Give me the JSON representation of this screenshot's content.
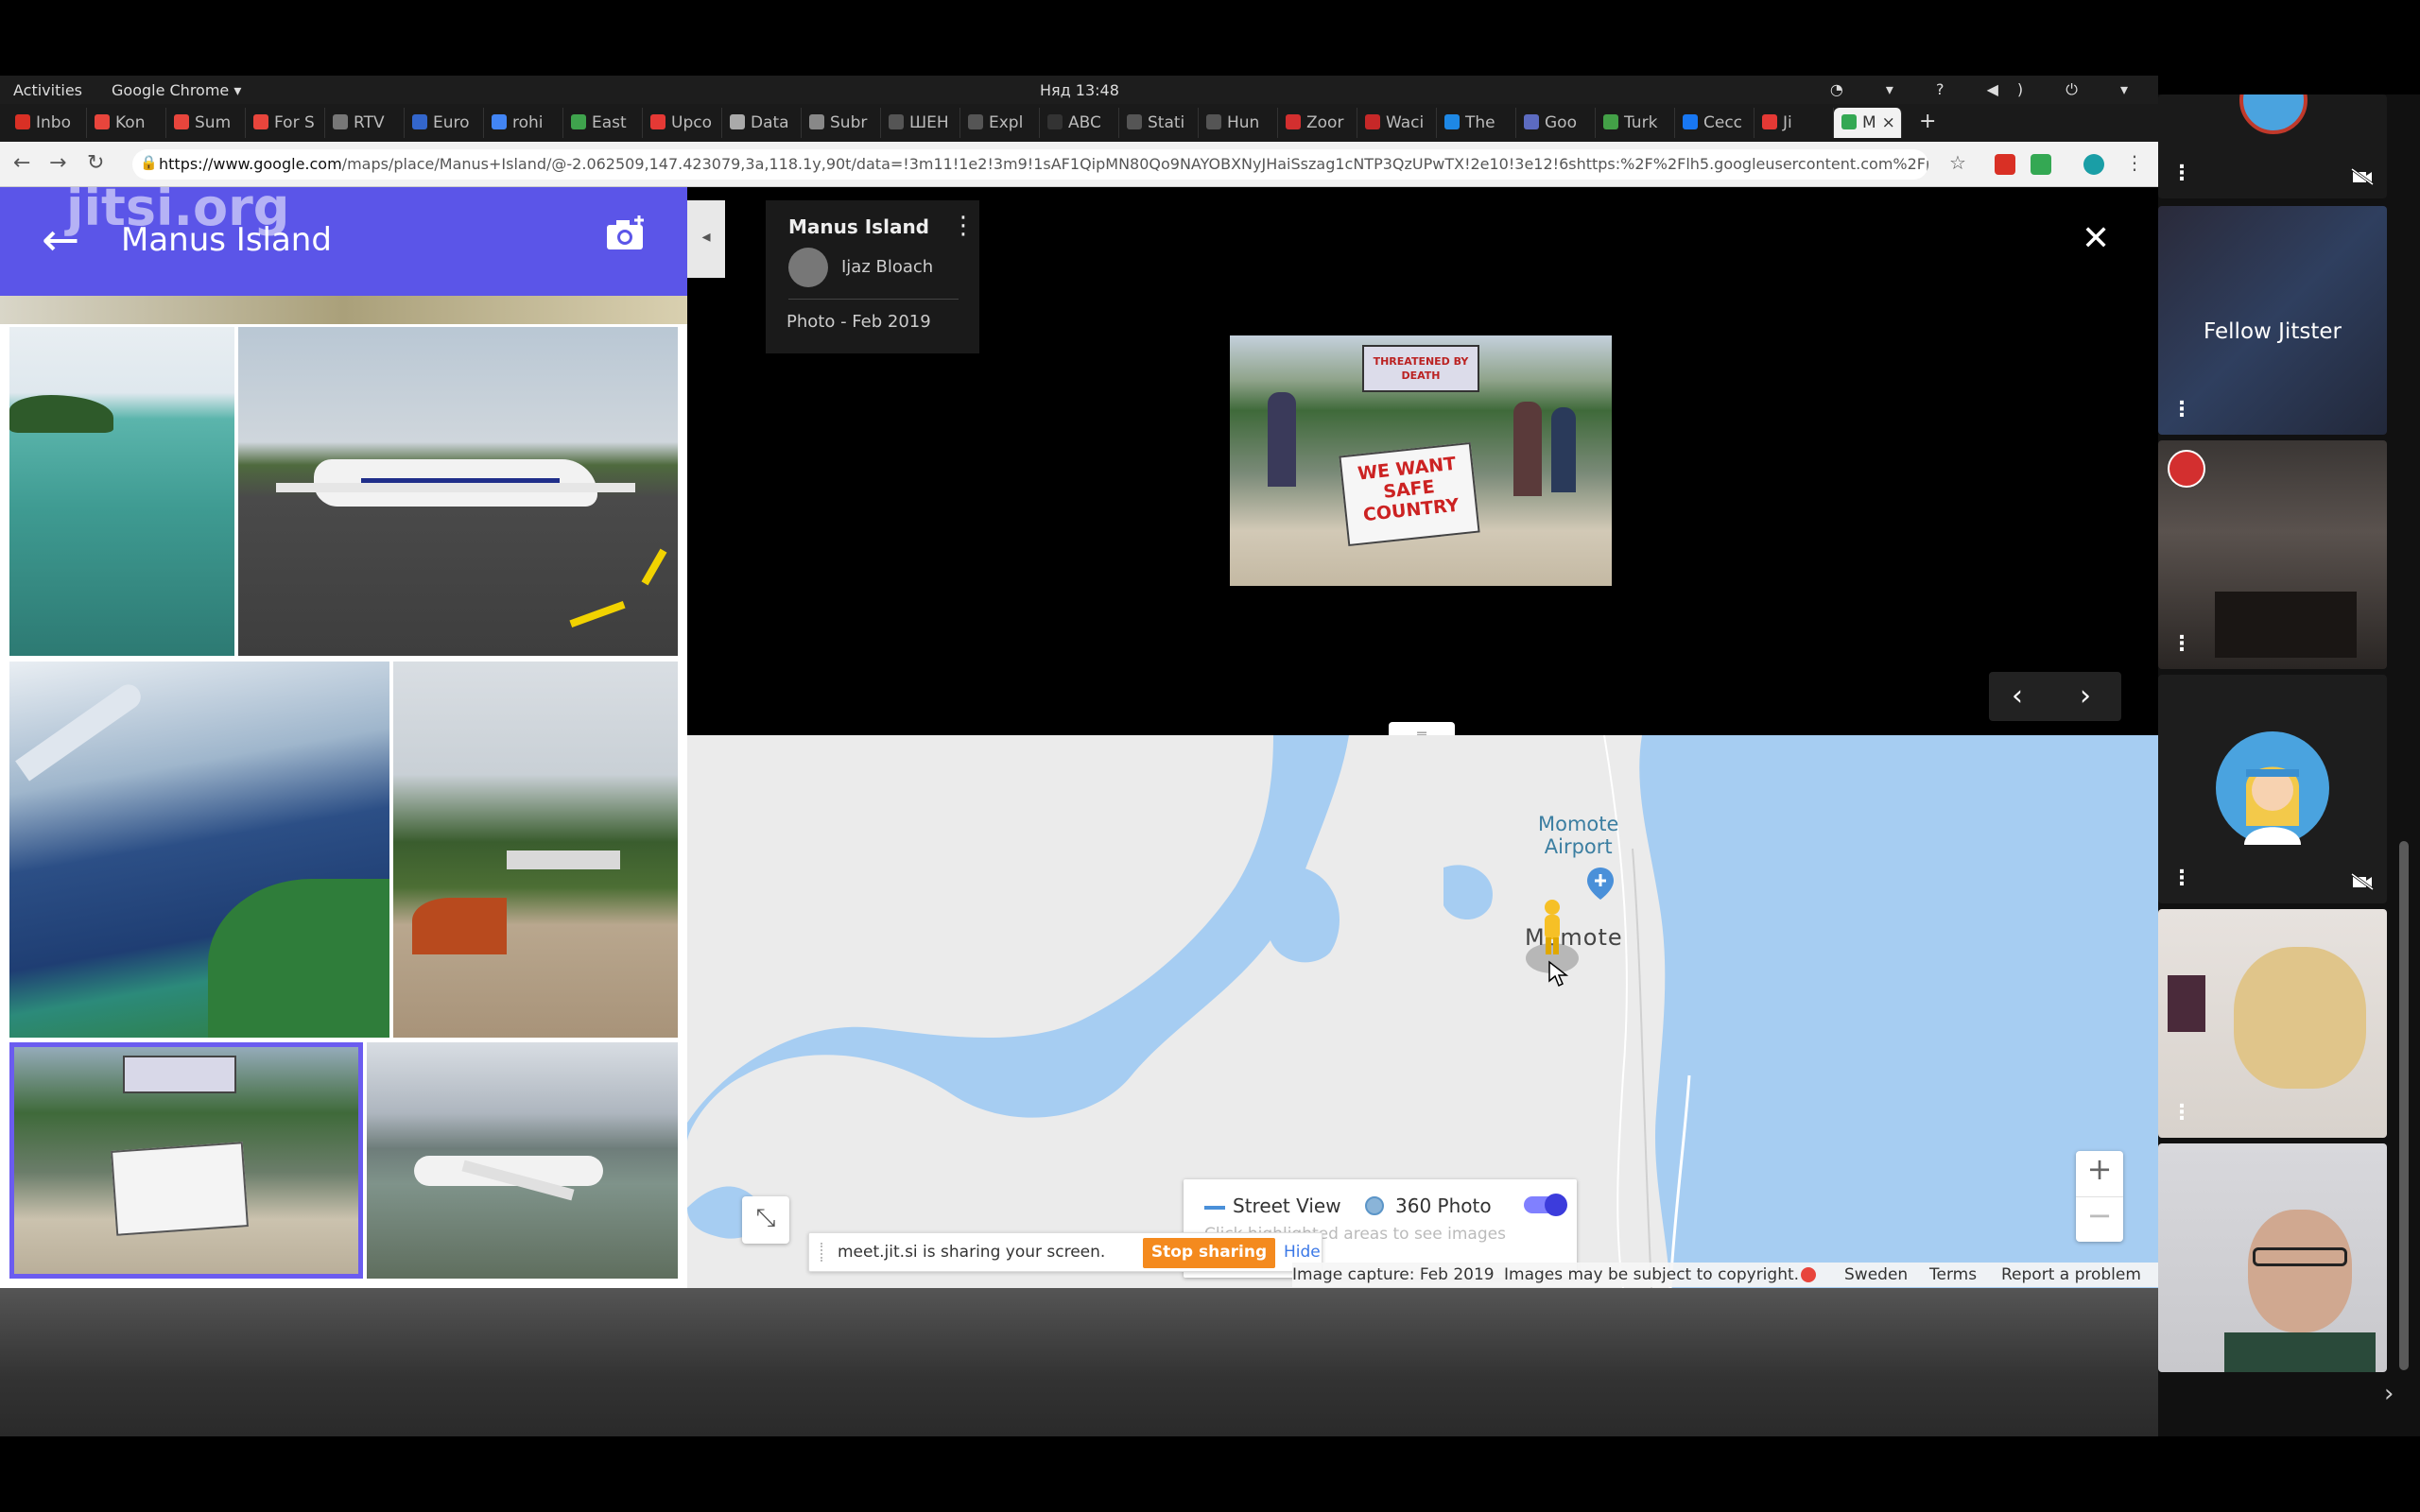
{
  "system": {
    "activities": "Activities",
    "app_menu": "Google Chrome ▾",
    "clock": "Няд 13:48"
  },
  "browser": {
    "tabs": [
      {
        "label": "Inbo",
        "color": "#d93025"
      },
      {
        "label": "Kon",
        "color": "#e8453c"
      },
      {
        "label": "Sum",
        "color": "#e8453c"
      },
      {
        "label": "For S",
        "color": "#e8453c"
      },
      {
        "label": "RTV",
        "color": "#777777"
      },
      {
        "label": "Euro",
        "color": "#3366cc"
      },
      {
        "label": "rohi",
        "color": "#4285f4"
      },
      {
        "label": "East",
        "color": "#3fa34d"
      },
      {
        "label": "Upco",
        "color": "#e53935"
      },
      {
        "label": "Data",
        "color": "#aaaaaa"
      },
      {
        "label": "Subr",
        "color": "#888888"
      },
      {
        "label": "ШЕН",
        "color": "#555555"
      },
      {
        "label": "Expl",
        "color": "#555555"
      },
      {
        "label": "ABC",
        "color": "#333333"
      },
      {
        "label": "Stati",
        "color": "#555555"
      },
      {
        "label": "Hun",
        "color": "#555555"
      },
      {
        "label": "Zoor",
        "color": "#d32f2f"
      },
      {
        "label": "Waci",
        "color": "#c62828"
      },
      {
        "label": "The",
        "color": "#1e88e5"
      },
      {
        "label": "Goo",
        "color": "#5c6bc0"
      },
      {
        "label": "Turk",
        "color": "#43a047"
      },
      {
        "label": "Сесс",
        "color": "#1877f2"
      },
      {
        "label": "Ji",
        "color": "#e53935"
      },
      {
        "label": "M",
        "color": "#34a853"
      }
    ],
    "active_tab_close": "×",
    "new_tab": "+",
    "url_host": "https://www.google.com",
    "url_path": "/maps/place/Manus+Island/@-2.062509,147.423079,3a,118.1y,90t/data=!3m11!1e2!3m9!1sAF1QipMN80Qo9NAYOBXNyJHaiSszag1cNTP3QzUPwTX!2e10!3e12!6shttps:%2F%2Flh5.googleusercontent.com%2Fp%2FAF1Qi..."
  },
  "left_panel": {
    "watermark": "jitsi.org",
    "back_arrow": "←",
    "title": "Manus Island"
  },
  "viewer": {
    "collapse_arrow": "◂",
    "card_title": "Manus Island",
    "card_more": "⋮",
    "author": "Ijaz Bloach",
    "date": "Photo - Feb 2019",
    "close": "✕",
    "prev": "‹",
    "next": "›",
    "photo_sign_top": "THREATENED BY DEATH",
    "photo_sign_main": "WE WANT SAFE COUNTRY"
  },
  "map": {
    "airport_label_1": "Momote",
    "airport_label_2": "Airport",
    "town_label": "Momote",
    "zoom_in": "+",
    "zoom_out": "−",
    "fullscreen": "⤡",
    "legend_street_view": "Street View",
    "legend_360": "360 Photo",
    "legend_hint": "Click highlighted areas to see images",
    "toggle_on": true,
    "footer": {
      "capture": "Image capture: Feb 2019",
      "copyright": "Images may be subject to copyright.",
      "country": "Sweden",
      "terms": "Terms",
      "report": "Report a problem"
    }
  },
  "share_bar": {
    "message": "meet.jit.si is sharing your screen.",
    "stop": "Stop sharing",
    "hide": "Hide"
  },
  "filmstrip": {
    "fellow_name": "Fellow Jitster",
    "more": "⋮",
    "next": "›"
  }
}
